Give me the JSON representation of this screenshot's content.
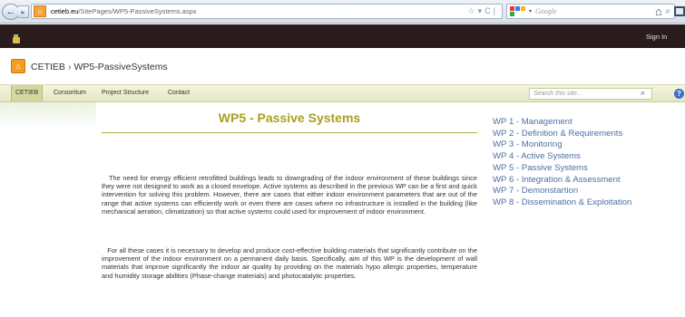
{
  "browser": {
    "url_domain": "cetieb.eu",
    "url_path": "/SitePages/WP5-PassiveSystems.aspx",
    "search_engine": "Google"
  },
  "topbar": {
    "sign_in": "Sign In"
  },
  "site": {
    "name": "CETIEB",
    "separator": "›",
    "page": "WP5-PassiveSystems"
  },
  "nav": {
    "items": [
      "CETIEB",
      "Consortium",
      "Project Structure",
      "Contact"
    ],
    "search_placeholder": "Search this site..."
  },
  "content": {
    "heading": "WP5 - Passive Systems",
    "paragraph1": "The need for energy efficient retrofitted buildings leads to downgrading of the indoor environment of these buildings since they were not designed to work as a closed envelope. Active systems as described in the previous WP can be a first and quick intervention for solving this problem. However, there are cases that either indoor environment parameters that are out of the range that active systems can efficiently work or even there are cases where no infrastructure is installed in the building (like mechanical aeration, climatization) so that active systems could used for improvement of indoor environment.",
    "paragraph2": "For all these cases it is necessary to develop and produce cost-effective building materials that significantly contribute on the improvement of the indoor environment on a permanent daily basis. Specifically, aim of this WP is the development of wall materials that improve significantly the indoor air quality by providing on the materials hypo allergic properties, temperature and humidity storage abilities (Phase-change materials) and photocatalytic properties."
  },
  "wp_links": [
    "WP 1 - Management",
    "WP 2 - Definition & Requirements",
    "WP 3 - Monitoring",
    "WP 4 - Active Systems",
    "WP 5 - Passive Systems",
    "WP 6 - Integration & Assessment",
    "WP 7 - Demonstartion",
    "WP 8 - Dissemination & Exploitation"
  ],
  "colors": {
    "heading": "#a8a020",
    "link": "#4d6fa3",
    "topbar": "#2a1c1c",
    "nav": "#e5e7c2"
  },
  "icons": {
    "back": "back-arrow-icon",
    "forward": "forward-arrow-icon",
    "home": "home-icon",
    "search": "magnifier-icon",
    "help": "help-icon"
  }
}
